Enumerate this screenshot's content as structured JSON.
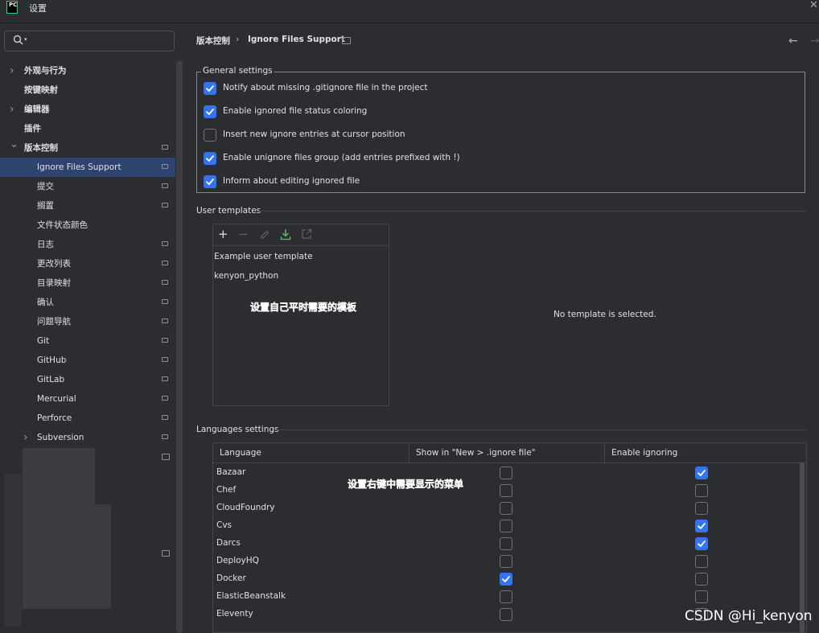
{
  "window": {
    "logo_text": "PC",
    "title": "设置",
    "close_icon": "close-icon"
  },
  "search": {
    "placeholder": "",
    "value": "",
    "icon": "search-icon"
  },
  "sidebar": {
    "items": [
      {
        "label": "外观与行为",
        "expandable": true,
        "expanded": false,
        "indent": 0,
        "settings_page_icon": false,
        "selected": false
      },
      {
        "label": "按键映射",
        "expandable": false,
        "indent": 0,
        "settings_page_icon": false,
        "selected": false
      },
      {
        "label": "编辑器",
        "expandable": true,
        "expanded": false,
        "indent": 0,
        "settings_page_icon": false,
        "selected": false
      },
      {
        "label": "插件",
        "expandable": false,
        "indent": 0,
        "settings_page_icon": false,
        "selected": false
      },
      {
        "label": "版本控制",
        "expandable": true,
        "expanded": true,
        "indent": 0,
        "settings_page_icon": true,
        "selected": false
      },
      {
        "label": "Ignore Files Support",
        "expandable": false,
        "indent": 1,
        "settings_page_icon": true,
        "selected": true
      },
      {
        "label": "提交",
        "expandable": false,
        "indent": 1,
        "settings_page_icon": true,
        "selected": false
      },
      {
        "label": "搁置",
        "expandable": false,
        "indent": 1,
        "settings_page_icon": true,
        "selected": false
      },
      {
        "label": "文件状态颜色",
        "expandable": false,
        "indent": 1,
        "settings_page_icon": false,
        "selected": false
      },
      {
        "label": "日志",
        "expandable": false,
        "indent": 1,
        "settings_page_icon": true,
        "selected": false
      },
      {
        "label": "更改列表",
        "expandable": false,
        "indent": 1,
        "settings_page_icon": true,
        "selected": false
      },
      {
        "label": "目录映射",
        "expandable": false,
        "indent": 1,
        "settings_page_icon": true,
        "selected": false
      },
      {
        "label": "确认",
        "expandable": false,
        "indent": 1,
        "settings_page_icon": true,
        "selected": false
      },
      {
        "label": "问题导航",
        "expandable": false,
        "indent": 1,
        "settings_page_icon": true,
        "selected": false
      },
      {
        "label": "Git",
        "expandable": false,
        "indent": 1,
        "settings_page_icon": true,
        "selected": false
      },
      {
        "label": "GitHub",
        "expandable": false,
        "indent": 1,
        "settings_page_icon": true,
        "selected": false
      },
      {
        "label": "GitLab",
        "expandable": false,
        "indent": 1,
        "settings_page_icon": true,
        "selected": false
      },
      {
        "label": "Mercurial",
        "expandable": false,
        "indent": 1,
        "settings_page_icon": true,
        "selected": false
      },
      {
        "label": "Perforce",
        "expandable": false,
        "indent": 1,
        "settings_page_icon": true,
        "selected": false
      },
      {
        "label": "Subversion",
        "expandable": true,
        "expanded": false,
        "indent": 1,
        "settings_page_icon": true,
        "selected": false
      }
    ]
  },
  "header": {
    "breadcrumb": [
      "版本控制",
      "Ignore Files Support"
    ],
    "breadcrumb_separator": "›",
    "back_icon": "back-arrow-icon",
    "forward_icon": "forward-arrow-icon"
  },
  "general_settings": {
    "title": "General settings",
    "options": [
      {
        "label": "Notify about missing .gitignore file in the project",
        "checked": true
      },
      {
        "label": "Enable ignored file status coloring",
        "checked": true
      },
      {
        "label": "Insert new ignore entries at cursor position",
        "checked": false
      },
      {
        "label": "Enable unignore files group (add entries prefixed with !)",
        "checked": true
      },
      {
        "label": "Inform about editing ignored file",
        "checked": true
      }
    ]
  },
  "user_templates": {
    "title": "User templates",
    "toolbar_icons": [
      "add-icon",
      "remove-icon",
      "edit-icon",
      "import-icon",
      "export-icon"
    ],
    "items": [
      "Example user template",
      "kenyon_python"
    ],
    "empty_message": "No template is selected.",
    "annotation": "设置自己平时需要的模板"
  },
  "languages_settings": {
    "title": "Languages settings",
    "columns": [
      "Language",
      "Show in \"New > .ignore file\"",
      "Enable ignoring"
    ],
    "rows": [
      {
        "name": "Bazaar",
        "show_in_new": false,
        "enable_ignoring": true
      },
      {
        "name": "Chef",
        "show_in_new": false,
        "enable_ignoring": false
      },
      {
        "name": "CloudFoundry",
        "show_in_new": false,
        "enable_ignoring": false
      },
      {
        "name": "Cvs",
        "show_in_new": false,
        "enable_ignoring": true
      },
      {
        "name": "Darcs",
        "show_in_new": false,
        "enable_ignoring": true
      },
      {
        "name": "DeployHQ",
        "show_in_new": false,
        "enable_ignoring": false
      },
      {
        "name": "Docker",
        "show_in_new": true,
        "enable_ignoring": false
      },
      {
        "name": "ElasticBeanstalk",
        "show_in_new": false,
        "enable_ignoring": false
      },
      {
        "name": "Eleventy",
        "show_in_new": false,
        "enable_ignoring": false
      }
    ],
    "annotation": "设置右键中需要显示的菜单"
  },
  "watermark": "CSDN @Hi_kenyon",
  "colors": {
    "accent": "#3574f0",
    "selection": "#2e436e",
    "background": "#2b2d30",
    "annotation": "#e31e1e"
  }
}
